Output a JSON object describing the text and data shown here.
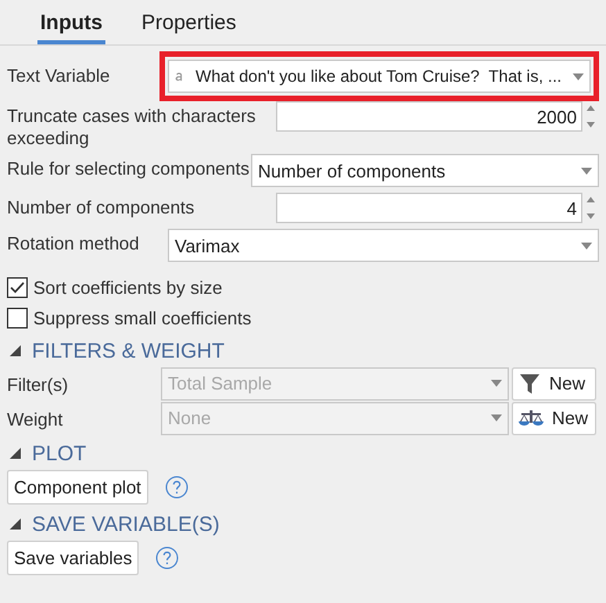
{
  "tabs": [
    {
      "label": "Inputs",
      "selected": true
    },
    {
      "label": "Properties",
      "selected": false
    }
  ],
  "inputs": [
    {
      "kind": "variable",
      "label": "Text Variable",
      "value": "What don't you like about Tom Cruise?  That is, ...",
      "highlighted": true
    },
    {
      "kind": "spinner",
      "label": "Truncate cases with characters exceeding",
      "value": "2000"
    },
    {
      "kind": "select",
      "label": "Rule for selecting components",
      "value": "Number of components"
    },
    {
      "kind": "spinner",
      "label": "Number of components",
      "value": "4"
    },
    {
      "kind": "select",
      "label": "Rotation method",
      "value": "Varimax"
    }
  ],
  "checkboxes": [
    {
      "label": "Sort coefficients by size",
      "checked": true
    },
    {
      "label": "Suppress small coefficients",
      "checked": false
    }
  ],
  "sections": [
    {
      "kind": "pickers",
      "title": "FILTERS & WEIGHT",
      "expanded": true,
      "rows": [
        {
          "kind": "filter",
          "label": "Filter(s)",
          "value": "Total Sample",
          "disabled": true,
          "button": "New"
        },
        {
          "kind": "weight",
          "label": "Weight",
          "value": "None",
          "disabled": true,
          "button": "New"
        }
      ]
    },
    {
      "kind": "action",
      "title": "PLOT",
      "expanded": true,
      "button": "Component plot"
    },
    {
      "kind": "action",
      "title": "SAVE VARIABLE(S)",
      "expanded": true,
      "button": "Save variables"
    }
  ]
}
